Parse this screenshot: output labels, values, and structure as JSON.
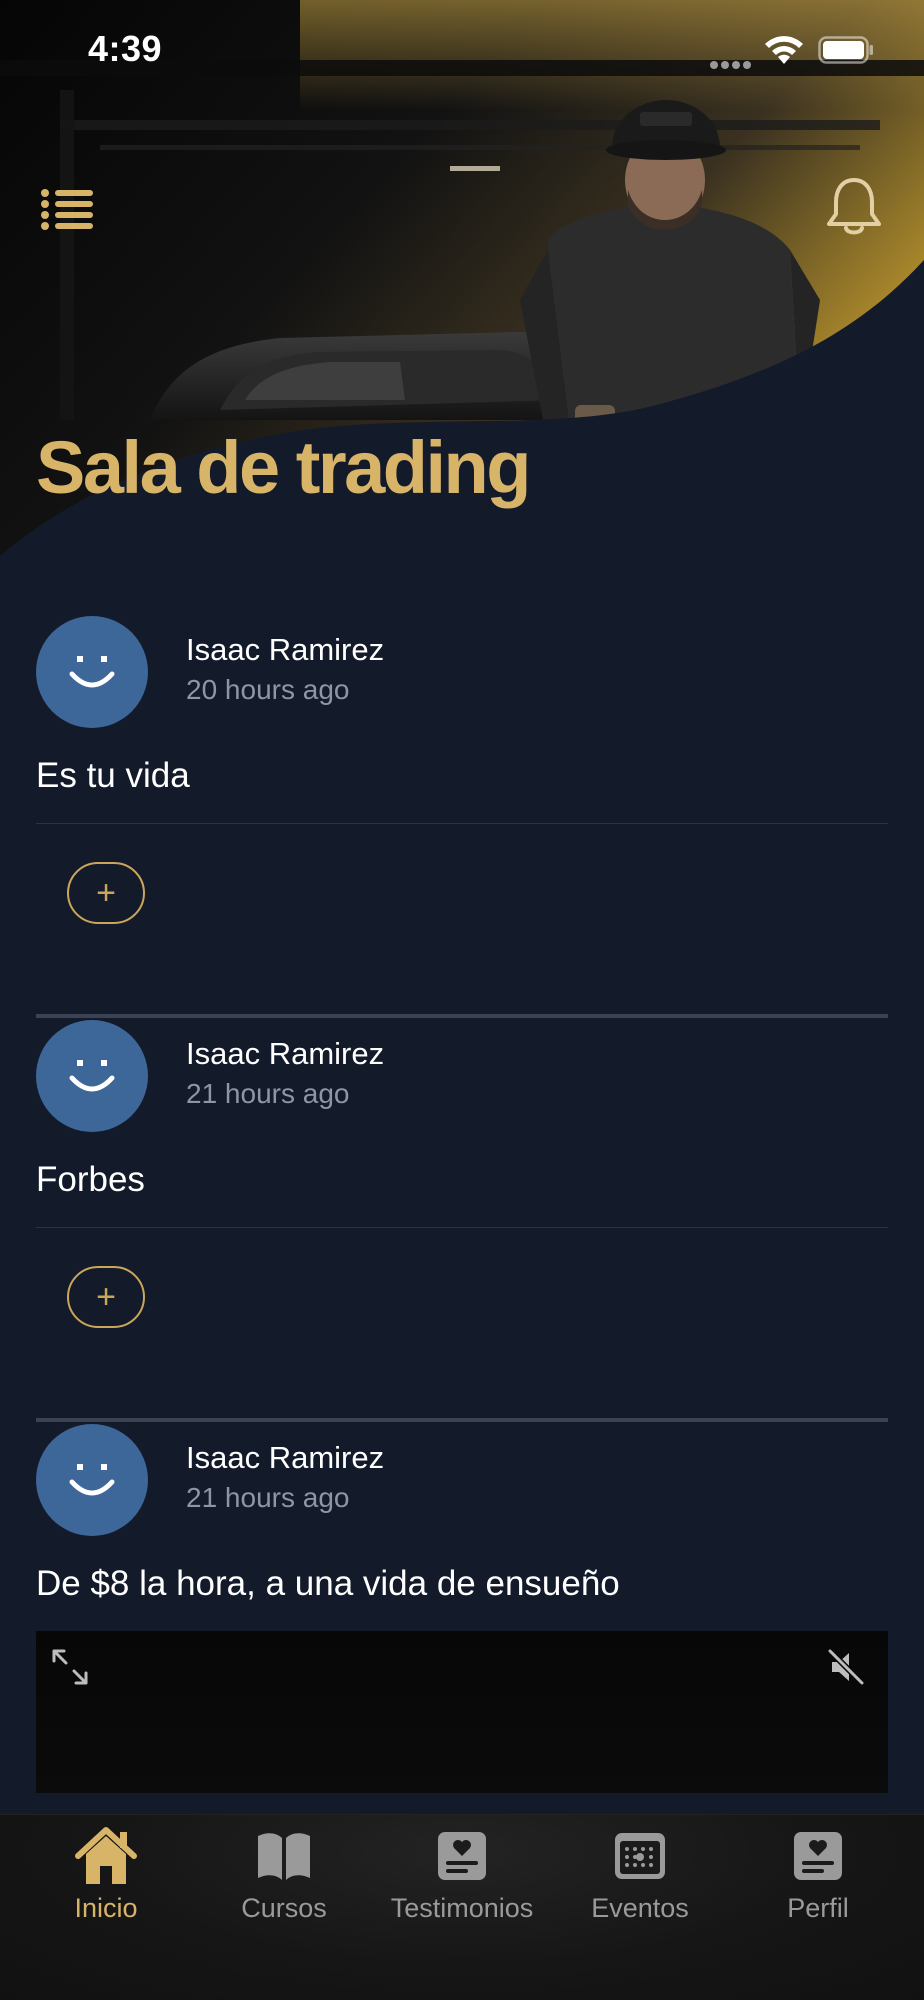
{
  "status_bar": {
    "time": "4:39"
  },
  "header": {
    "title": "Sala de trading"
  },
  "posts": [
    {
      "author": "Isaac Ramirez",
      "time": "20 hours ago",
      "text": "Es tu vida",
      "react_label": "+"
    },
    {
      "author": "Isaac Ramirez",
      "time": "21 hours ago",
      "text": "Forbes",
      "react_label": "+"
    },
    {
      "author": "Isaac Ramirez",
      "time": "21 hours ago",
      "text": "De $8 la hora, a una vida de ensueño"
    }
  ],
  "tabbar": {
    "items": [
      {
        "label": "Inicio",
        "icon": "home-icon",
        "active": true
      },
      {
        "label": "Cursos",
        "icon": "book-icon",
        "active": false
      },
      {
        "label": "Testimonios",
        "icon": "testimonial-card-icon",
        "active": false
      },
      {
        "label": "Eventos",
        "icon": "event-board-icon",
        "active": false
      },
      {
        "label": "Perfil",
        "icon": "profile-card-icon",
        "active": false
      }
    ]
  },
  "colors": {
    "background": "#131a2a",
    "accent_gold": "#d7b468",
    "avatar_blue": "#3d6699",
    "muted_text": "#8f96a3",
    "tab_inactive": "#9a9a9a"
  }
}
